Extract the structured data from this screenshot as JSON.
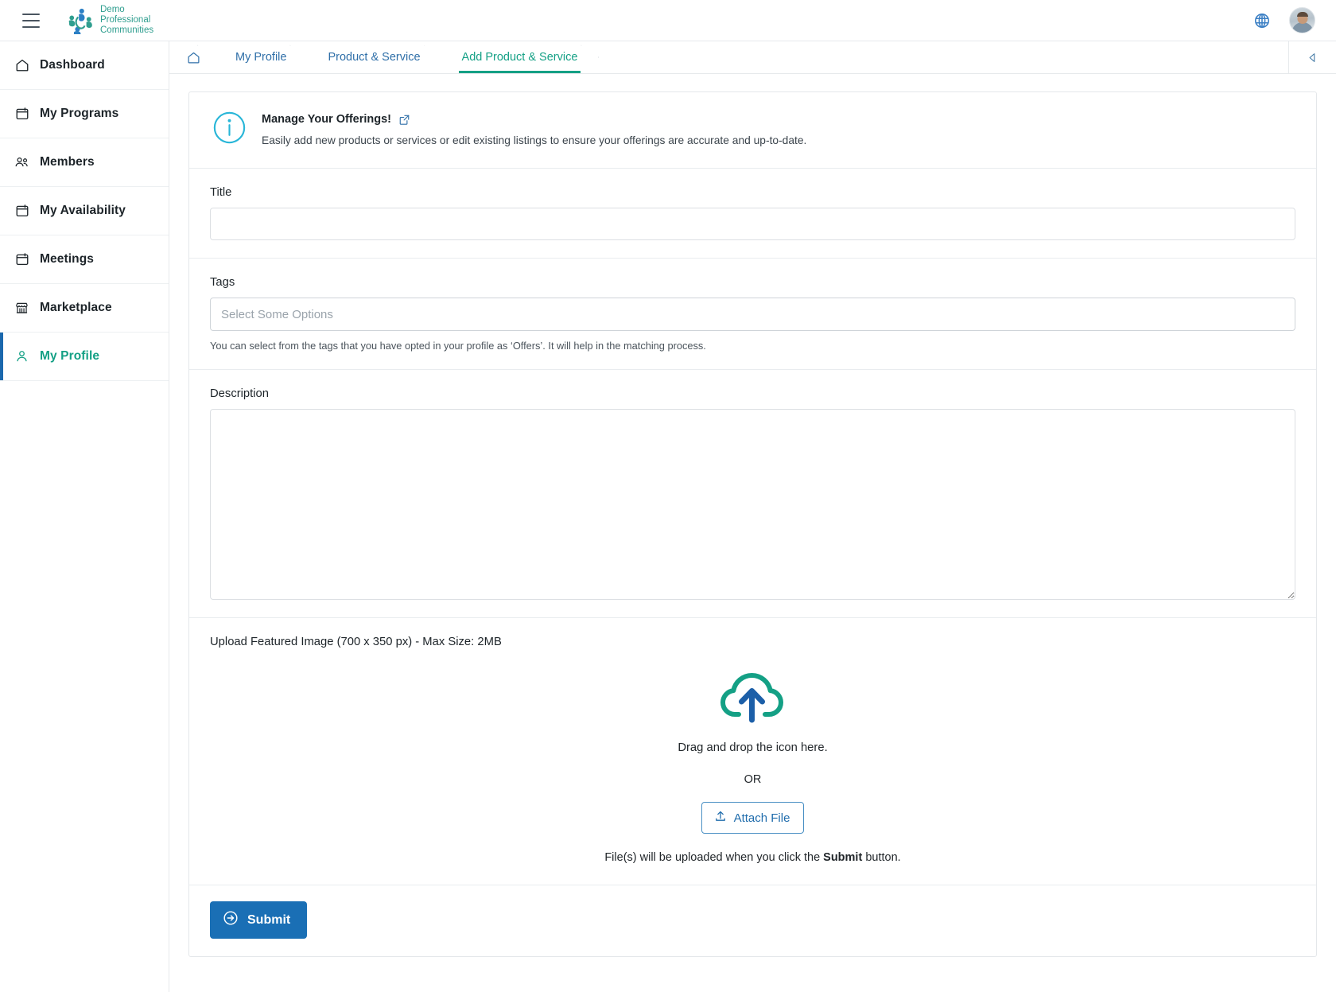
{
  "header": {
    "menu_icon": "hamburger-menu-icon",
    "logo": {
      "line1": "Demo",
      "line2": "Professional",
      "line3": "Communities",
      "icon": "people-logo-icon"
    },
    "language_icon": "globe-icon",
    "avatar_icon": "user-avatar"
  },
  "sidebar": {
    "items": [
      {
        "label": "Dashboard",
        "icon": "home-icon",
        "active": false
      },
      {
        "label": "My Programs",
        "icon": "calendar-icon",
        "active": false
      },
      {
        "label": "Members",
        "icon": "people-icon",
        "active": false
      },
      {
        "label": "My Availability",
        "icon": "calendar-icon",
        "active": false
      },
      {
        "label": "Meetings",
        "icon": "calendar-icon",
        "active": false
      },
      {
        "label": "Marketplace",
        "icon": "storefront-icon",
        "active": false
      },
      {
        "label": "My Profile",
        "icon": "person-icon",
        "active": true
      }
    ]
  },
  "breadcrumb": {
    "home_icon": "home-icon",
    "items": [
      {
        "label": "My Profile",
        "active": false
      },
      {
        "label": "Product & Service",
        "active": false
      },
      {
        "label": "Add Product & Service",
        "active": true
      }
    ],
    "collapse_icon": "chevron-left-icon"
  },
  "info_banner": {
    "icon": "info-circle-icon",
    "title": "Manage Your Offerings!",
    "external_link_icon": "external-link-icon",
    "description": "Easily add new products or services or edit existing listings to ensure your offerings are accurate and up-to-date."
  },
  "form": {
    "title": {
      "label": "Title",
      "value": "",
      "placeholder": ""
    },
    "tags": {
      "label": "Tags",
      "value": "",
      "placeholder": "Select Some Options",
      "hint": "You can select from the tags that you have opted in your profile as ‘Offers’. It will help in the matching process."
    },
    "description": {
      "label": "Description",
      "value": "",
      "placeholder": ""
    }
  },
  "upload": {
    "label": "Upload Featured Image (700 x 350 px) - Max Size: 2MB",
    "cloud_icon": "cloud-upload-icon",
    "drag_text": "Drag and drop the icon here.",
    "or_text": "OR",
    "attach_button": {
      "label": "Attach File",
      "icon": "upload-icon"
    },
    "note_prefix": "File(s) will be uploaded when you click the ",
    "note_bold": "Submit",
    "note_suffix": " button."
  },
  "submit": {
    "label": "Submit",
    "icon": "arrow-right-circle-icon"
  },
  "colors": {
    "teal": "#14a085",
    "blue": "#1a6fb5",
    "link_blue": "#2f6fa8",
    "info_cyan": "#29b6d8",
    "border": "#e4e7ea"
  }
}
